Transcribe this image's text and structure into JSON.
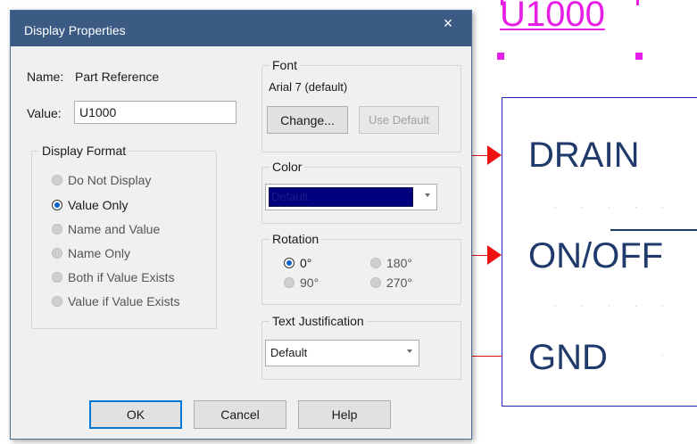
{
  "canvas": {
    "reference": "U1000",
    "pins": [
      "DRAIN",
      "ON/OFF",
      "GND"
    ]
  },
  "dialog": {
    "title": "Display Properties",
    "close_glyph": "×",
    "name_label": "Name:",
    "name_value": "Part Reference",
    "value_label": "Value:",
    "value_text": "U1000",
    "display_format": {
      "title": "Display Format",
      "options": [
        {
          "label": "Do Not Display",
          "checked": false
        },
        {
          "label": "Value Only",
          "checked": true
        },
        {
          "label": "Name and Value",
          "checked": false
        },
        {
          "label": "Name Only",
          "checked": false
        },
        {
          "label": "Both if Value Exists",
          "checked": false
        },
        {
          "label": "Value if Value Exists",
          "checked": false
        }
      ]
    },
    "font": {
      "title": "Font",
      "current": "Arial 7 (default)",
      "change_label": "Change...",
      "use_default_label": "Use Default"
    },
    "color": {
      "title": "Color",
      "selected": "Default",
      "swatch": "#00007f"
    },
    "rotation": {
      "title": "Rotation",
      "options": [
        {
          "label": "0°",
          "checked": true
        },
        {
          "label": "180°",
          "checked": false
        },
        {
          "label": "90°",
          "checked": false
        },
        {
          "label": "270°",
          "checked": false
        }
      ]
    },
    "justification": {
      "title": "Text Justification",
      "selected": "Default"
    },
    "buttons": {
      "ok": "OK",
      "cancel": "Cancel",
      "help": "Help"
    }
  },
  "colors": {
    "titlebar": "#3b5b85",
    "reference": "#e61ee6",
    "pin_text": "#1f3a6b",
    "pin_arrow": "#e11111",
    "part_outline": "#2424b4"
  }
}
